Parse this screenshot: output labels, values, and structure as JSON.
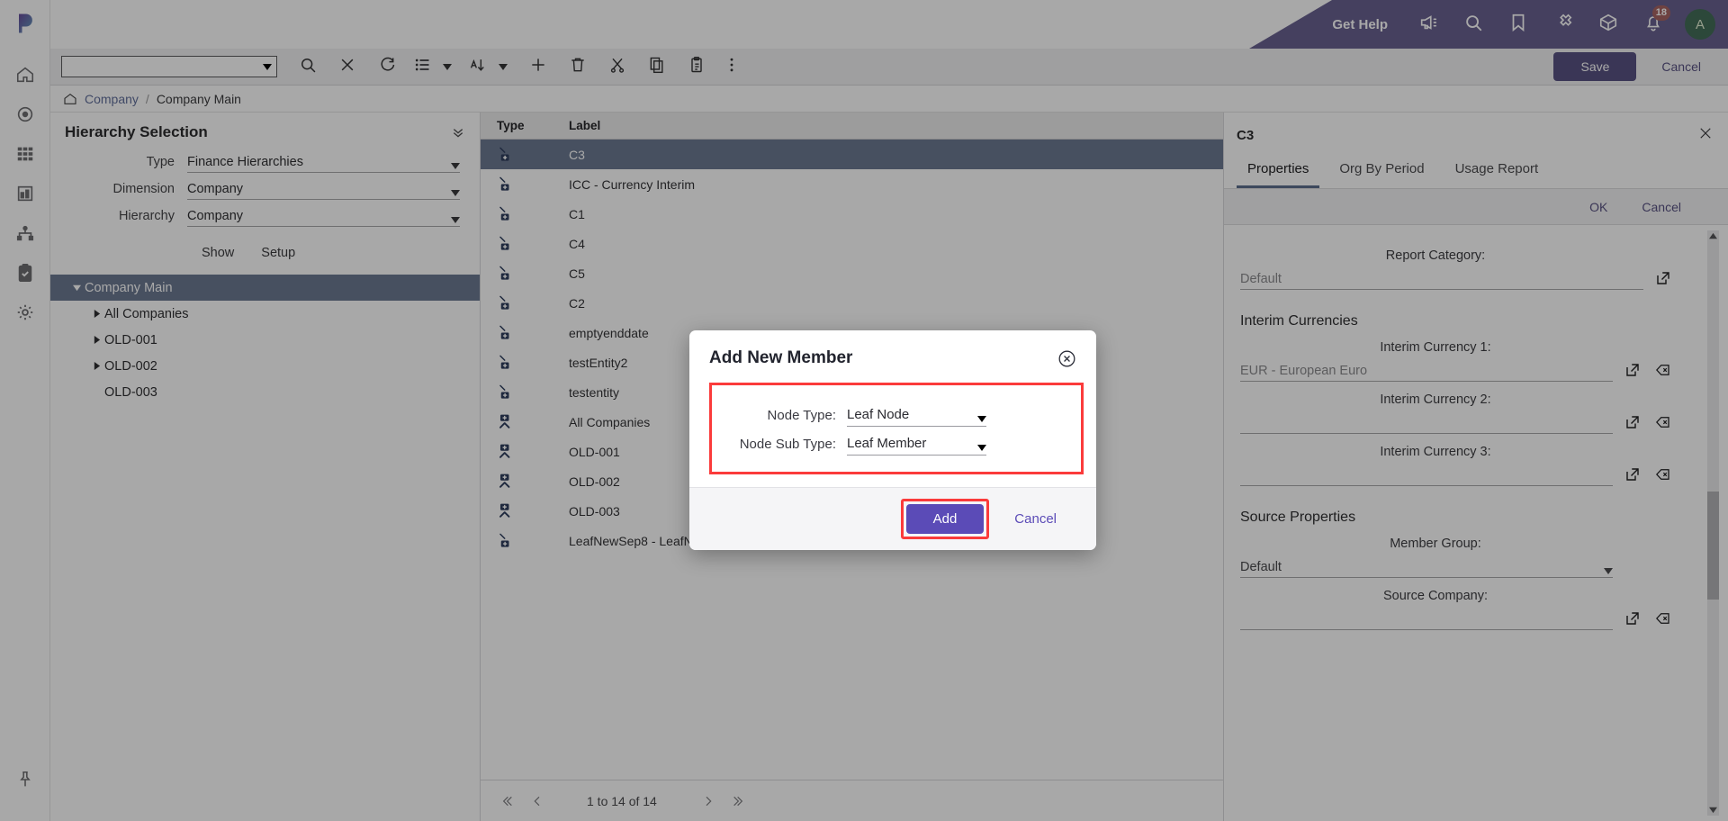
{
  "sidebar": {
    "logo": "p-logo",
    "items": [
      {
        "icon": "home-icon",
        "name": "home"
      },
      {
        "icon": "target-icon",
        "name": "target"
      },
      {
        "icon": "grid-icon",
        "name": "grid"
      },
      {
        "icon": "chart-icon",
        "name": "dashboard"
      },
      {
        "icon": "hierarchy-icon",
        "name": "hierarchy"
      },
      {
        "icon": "clipboard-check-icon",
        "name": "tasks"
      },
      {
        "icon": "gear-icon",
        "name": "settings"
      }
    ],
    "pin": {
      "icon": "pin-icon",
      "name": "pin"
    }
  },
  "header": {
    "get_help": "Get Help",
    "accent": "#6c5ac4",
    "icons": [
      {
        "icon": "megaphone-icon",
        "name": "announcements"
      },
      {
        "icon": "search-icon",
        "name": "search"
      },
      {
        "icon": "bookmark-icon",
        "name": "bookmarks"
      },
      {
        "icon": "puzzle-icon",
        "name": "extensions"
      },
      {
        "icon": "cube-icon",
        "name": "apps"
      },
      {
        "icon": "bell-icon",
        "name": "notifications"
      }
    ],
    "notification_count": "18",
    "avatar_initial": "A",
    "avatar_color": "#1b7a4b"
  },
  "toolbar": {
    "combo_value": "",
    "icons": [
      {
        "icon": "search-icon",
        "name": "search"
      },
      {
        "icon": "close-icon",
        "name": "clear"
      },
      {
        "icon": "refresh-icon",
        "name": "refresh"
      },
      {
        "icon": "list-icon",
        "name": "view-list"
      },
      {
        "icon": "sort-icon",
        "name": "sort"
      },
      {
        "icon": "plus-icon",
        "name": "add"
      },
      {
        "icon": "trash-icon",
        "name": "delete"
      },
      {
        "icon": "scissors-icon",
        "name": "cut"
      },
      {
        "icon": "copy-icon",
        "name": "copy"
      },
      {
        "icon": "paste-icon",
        "name": "paste"
      },
      {
        "icon": "more-vertical-icon",
        "name": "more"
      }
    ],
    "save_label": "Save",
    "cancel_label": "Cancel"
  },
  "breadcrumb": {
    "home_icon": "home-icon",
    "root": "Company",
    "separator": "/",
    "current": "Company Main"
  },
  "hierarchy_selection": {
    "title": "Hierarchy Selection",
    "fields": [
      {
        "label": "Type",
        "value": "Finance Hierarchies"
      },
      {
        "label": "Dimension",
        "value": "Company"
      },
      {
        "label": "Hierarchy",
        "value": "Company"
      }
    ],
    "show_label": "Show",
    "setup_label": "Setup",
    "tree": [
      {
        "label": "Company Main",
        "level": 1,
        "expanded": true,
        "selected": true,
        "has_children": true
      },
      {
        "label": "All Companies",
        "level": 2,
        "expanded": false,
        "selected": false,
        "has_children": true
      },
      {
        "label": "OLD-001",
        "level": 2,
        "expanded": false,
        "selected": false,
        "has_children": true
      },
      {
        "label": "OLD-002",
        "level": 2,
        "expanded": false,
        "selected": false,
        "has_children": true
      },
      {
        "label": "OLD-003",
        "level": 2,
        "expanded": false,
        "selected": false,
        "has_children": false
      }
    ]
  },
  "grid": {
    "columns": [
      "Type",
      "Label"
    ],
    "rows": [
      {
        "type": "leaf",
        "label": "C3",
        "selected": true
      },
      {
        "type": "leaf",
        "label": "ICC - Currency Interim",
        "selected": false
      },
      {
        "type": "leaf",
        "label": "C1",
        "selected": false
      },
      {
        "type": "leaf",
        "label": "C4",
        "selected": false
      },
      {
        "type": "leaf",
        "label": "C5",
        "selected": false
      },
      {
        "type": "leaf",
        "label": "C2",
        "selected": false
      },
      {
        "type": "leaf",
        "label": "emptyenddate",
        "selected": false
      },
      {
        "type": "leaf",
        "label": "testEntity2",
        "selected": false
      },
      {
        "type": "leaf",
        "label": "testentity",
        "selected": false
      },
      {
        "type": "parent",
        "label": "All Companies",
        "selected": false
      },
      {
        "type": "parent",
        "label": "OLD-001",
        "selected": false
      },
      {
        "type": "parent",
        "label": "OLD-002",
        "selected": false
      },
      {
        "type": "parent",
        "label": "OLD-003",
        "selected": false
      },
      {
        "type": "leaf",
        "label": "LeafNewSep8 - LeafNewSep8",
        "selected": false
      }
    ],
    "pagination": "1 to 14 of 14"
  },
  "properties": {
    "title": "C3",
    "tabs": [
      {
        "label": "Properties",
        "active": true
      },
      {
        "label": "Org By Period",
        "active": false
      },
      {
        "label": "Usage Report",
        "active": false
      }
    ],
    "ok_label": "OK",
    "cancel_label": "Cancel",
    "report_category_label": "Report Category:",
    "report_category_value": "Default",
    "interim_section": "Interim Currencies",
    "interim": [
      {
        "label": "Interim Currency 1:",
        "value": "EUR - European Euro"
      },
      {
        "label": "Interim Currency 2:",
        "value": ""
      },
      {
        "label": "Interim Currency 3:",
        "value": ""
      }
    ],
    "source_section": "Source Properties",
    "member_group_label": "Member Group:",
    "member_group_value": "Default",
    "source_company_label": "Source Company:",
    "source_company_value": ""
  },
  "dialog": {
    "title": "Add New Member",
    "close_icon": "close-circle-icon",
    "fields": [
      {
        "label": "Node Type:",
        "value": "Leaf Node"
      },
      {
        "label": "Node Sub Type:",
        "value": "Leaf Member"
      }
    ],
    "add_label": "Add",
    "cancel_label": "Cancel",
    "highlight_color": "#fb3b3b"
  }
}
